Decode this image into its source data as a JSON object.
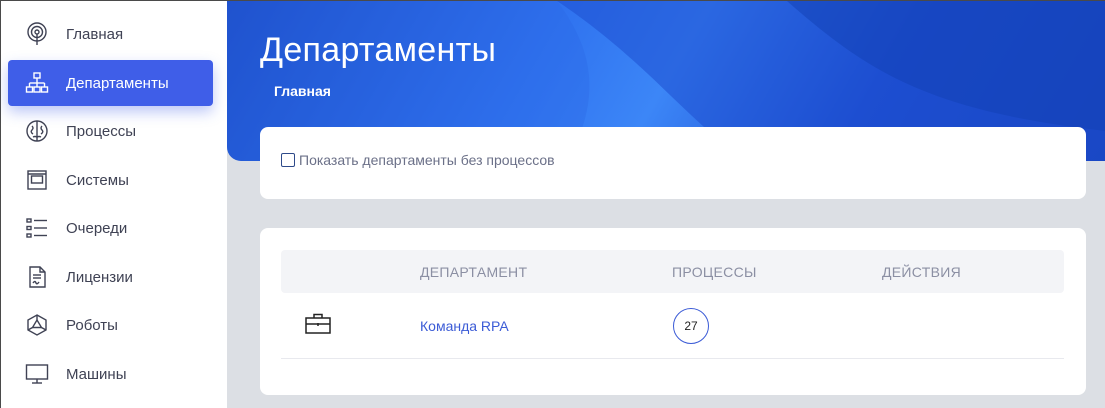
{
  "sidebar": {
    "items": [
      {
        "label": "Главная",
        "icon": "radar-icon",
        "active": false
      },
      {
        "label": "Департаменты",
        "icon": "hierarchy-icon",
        "active": true
      },
      {
        "label": "Процессы",
        "icon": "brain-icon",
        "active": false
      },
      {
        "label": "Системы",
        "icon": "window-icon",
        "active": false
      },
      {
        "label": "Очереди",
        "icon": "list-icon",
        "active": false
      },
      {
        "label": "Лицензии",
        "icon": "document-icon",
        "active": false
      },
      {
        "label": "Роботы",
        "icon": "robot-icon",
        "active": false
      },
      {
        "label": "Машины",
        "icon": "monitor-icon",
        "active": false
      }
    ]
  },
  "header": {
    "title": "Департаменты",
    "breadcrumb": "Главная"
  },
  "filter": {
    "label": "Показать департаменты без процессов",
    "checked": false
  },
  "table": {
    "columns": [
      "ДЕПАРТАМЕНТ",
      "ПРОЦЕССЫ",
      "ДЕЙСТВИЯ"
    ],
    "rows": [
      {
        "icon": "briefcase-icon",
        "department": "Команда RPA",
        "processes": "27",
        "actions": ""
      }
    ]
  },
  "colors": {
    "accent": "#3f5ee8",
    "banner": "#2f72ef",
    "link": "#3b5bd6",
    "background": "#dcdfe4"
  }
}
